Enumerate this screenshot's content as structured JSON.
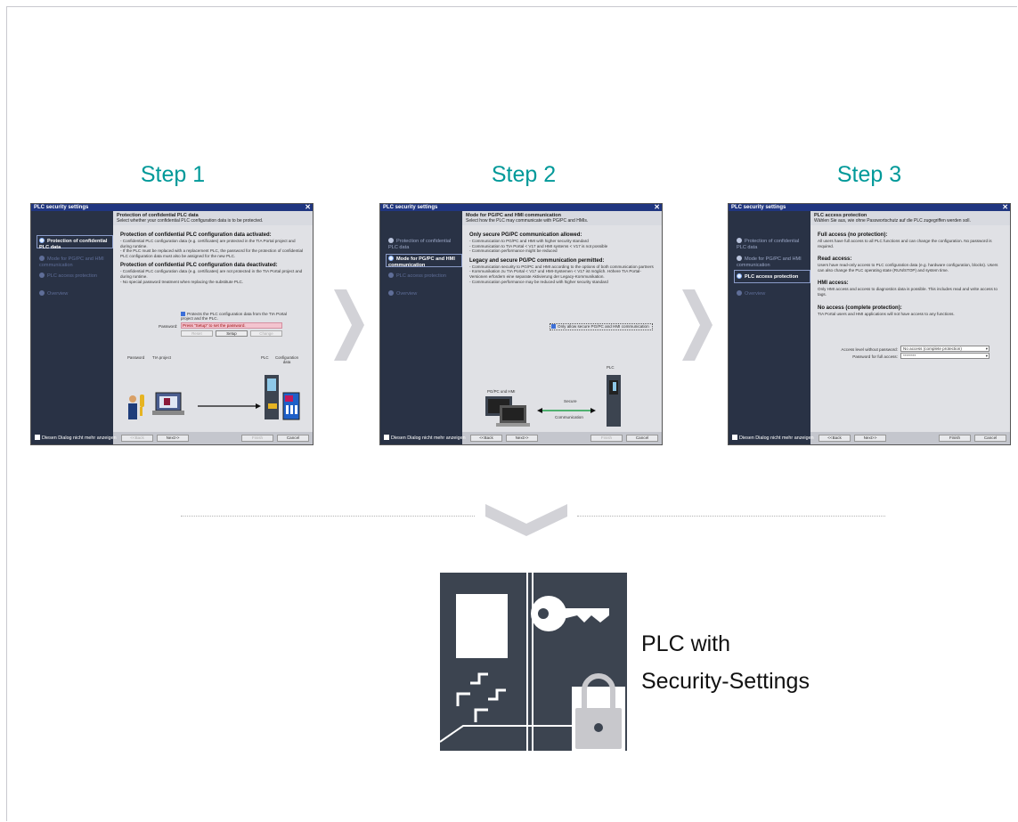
{
  "steps": [
    {
      "title": "Step 1"
    },
    {
      "title": "Step 2"
    },
    {
      "title": "Step 3"
    }
  ],
  "dialog": {
    "window_title": "PLC security settings",
    "nav_items": [
      "Protection of confidential PLC data",
      "Mode for PG/PC and HMI communication",
      "PLC access protection",
      "Overview"
    ],
    "footer_checkbox": "Diesen Dialog nicht mehr anzeigen",
    "btn_back": "<<Back",
    "btn_next": "Next>>",
    "btn_finish": "Finish",
    "btn_cancel": "Cancel"
  },
  "step1": {
    "head_title": "Protection of confidential PLC data",
    "head_sub": "Select whether your confidential PLC configuration data is to be protected.",
    "h1": "Protection of confidential PLC configuration data activated:",
    "p1": "- Confidential PLC configuration data (e.g. certificates) are protected in the TIA Portal project and during runtime.",
    "p2": "- If the PLC must be replaced with a replacement PLC, the password for the protection of confidential PLC configuration data must also be assigned for the new PLC.",
    "h2": "Protection of confidential PLC configuration data deactivated:",
    "p3": "- Confidential PLC configuration data (e.g. certificates) are not protected in the TIA Portal project and during runtime.",
    "p4": "- No special password treatment when replacing the substitute PLC.",
    "checkbox": "Protects the PLC configuration data from the TIA Portal project and the PLC.",
    "password_label": "Password:",
    "password_hint": "Press \"Setup\" to set the password.",
    "btn_reset": "Reset",
    "btn_setup": "Setup",
    "btn_change": "Change",
    "lbl_password": "Password",
    "lbl_tia": "TIA project",
    "lbl_plc": "PLC",
    "lbl_config": "Configuration data"
  },
  "step2": {
    "head_title": "Mode for PG/PC and HMI communication",
    "head_sub": "Select how the PLC may communicate with PG/PC and HMIs.",
    "h1": "Only secure PG/PC communication allowed:",
    "p1": "- Communication to PG/PC and HMI with higher security standard",
    "p2": "- Communication to TIA Portal < V17 and HMI systems < V17 is not possible",
    "p3": "- Communication performance might be reduced",
    "h2": "Legacy and secure PG/PC communication permitted:",
    "p4": "- Communication security to PG/PC and HMI according to the options of both communication partners",
    "p5": "- Kommunikation zu TIA Portal < V17 und HMI-Systemen < V17 ist möglich. Höhere TIA Portal-Versionen erfordern eine separate Aktivierung der Legacy-Kommunikation.",
    "p6": "- Communication performance may be reduced with higher security standard",
    "checkbox": "Only allow secure PG/PC and HMI communication",
    "lbl_pg": "PG/PC und HMI",
    "lbl_plc": "PLC",
    "lbl_secure": "Secure",
    "lbl_comm": "Communication"
  },
  "step3": {
    "head_title": "PLC access protection",
    "head_sub": "Wählen Sie aus, wie ohne Passwortschutz auf die PLC zugegriffen werden soll.",
    "h1": "Full access (no protection):",
    "p1": "All users have full access to all PLC functions and can change the configuration. No password is required.",
    "h2": "Read access:",
    "p2": "Users have read-only access to PLC configuration data (e.g. hardware configuration, blocks). Users can also change the PLC operating state (RUN/STOP) and system time.",
    "h3": "HMI access:",
    "p3": "Only HMI access and access to diagnostics data is possible. This includes read and write access to tags.",
    "h4": "No access (complete protection):",
    "p4": "TIA Portal users and HMI applications will not have access to any functions.",
    "lbl_access": "Access level without password:",
    "val_access": "No access (complete protection)",
    "lbl_pw": "Password for full access:",
    "val_pw": "********"
  },
  "result": {
    "line1": "PLC with",
    "line2": "Security-Settings"
  },
  "colors": {
    "accent": "#009999",
    "dark": "#3c4450",
    "chevron": "#d2d2d7"
  }
}
